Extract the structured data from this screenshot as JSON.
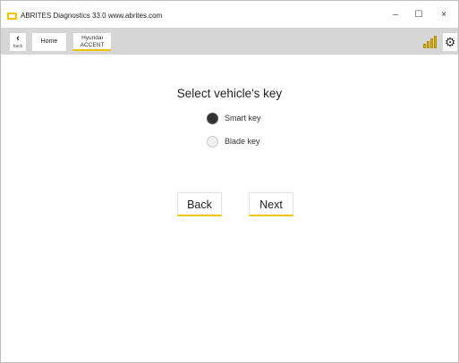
{
  "window": {
    "title": "ABRITES Diagnostics 33.0  www.abrites.com",
    "controls": {
      "minimize": "–",
      "maximize": "☐",
      "close": "×"
    }
  },
  "toolbar": {
    "back_label": "back",
    "home_label": "Home",
    "vehicle": {
      "make": "Hyundai",
      "model": "ACCENT"
    },
    "icons": [
      "back-chevron-icon",
      "signal-strength-icon",
      "gear-icon"
    ]
  },
  "main": {
    "heading": "Select vehicle's key",
    "options": [
      {
        "label": "Smart key",
        "selected": true
      },
      {
        "label": "Blade key",
        "selected": false
      }
    ],
    "buttons": {
      "back": "Back",
      "next": "Next"
    }
  },
  "colors": {
    "accent": "#f2c400",
    "toolbar_bg": "#d6d6d6"
  }
}
